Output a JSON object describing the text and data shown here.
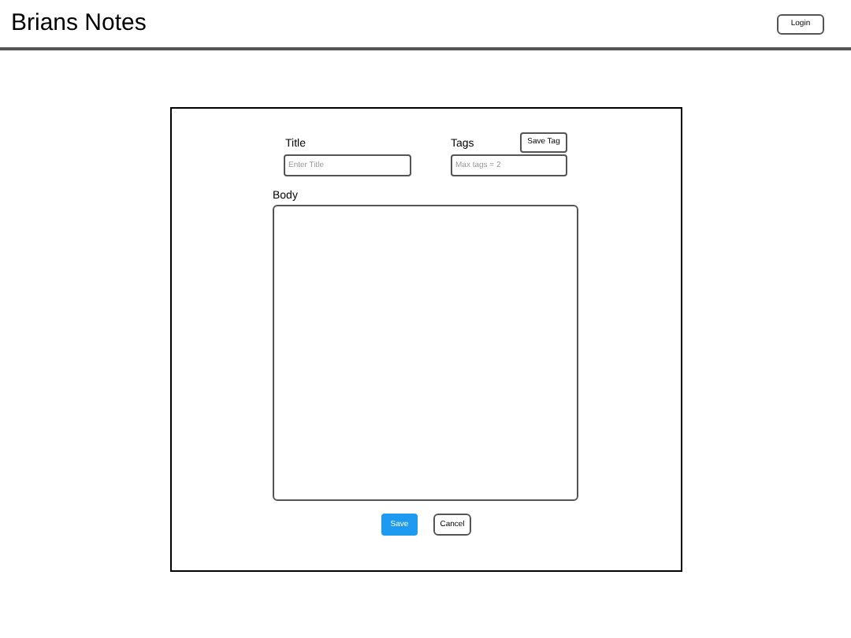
{
  "header": {
    "title": "Brians Notes",
    "login_button": "Login"
  },
  "form": {
    "title_label": "Title",
    "title_placeholder": "Enter Title",
    "tags_label": "Tags",
    "save_tag_button": "Save Tag",
    "tags_placeholder": "Max tags = 2",
    "body_label": "Body",
    "save_button": "Save",
    "cancel_button": "Cancel"
  }
}
